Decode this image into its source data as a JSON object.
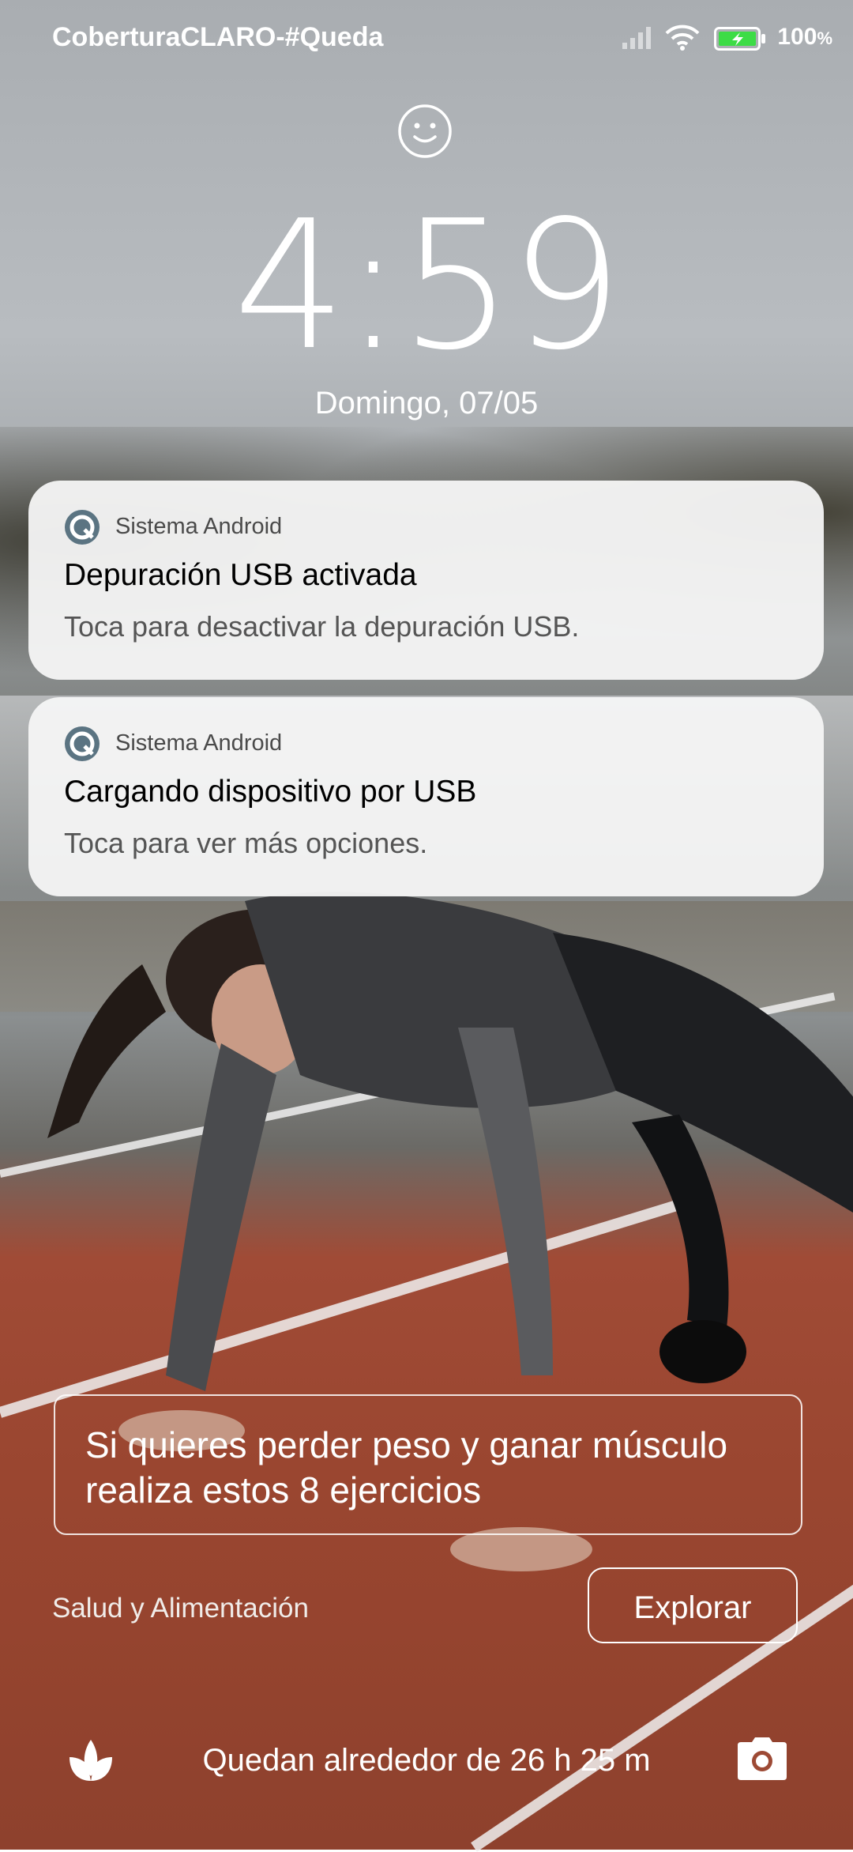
{
  "status_bar": {
    "carrier": "CoberturaCLARO-#Queda",
    "battery_percent": "100",
    "battery_unit": "%"
  },
  "lockscreen": {
    "time": "4:59",
    "date": "Domingo, 07/05"
  },
  "notifications": [
    {
      "app": "Sistema Android",
      "title": "Depuración USB activada",
      "text": "Toca para desactivar la depuración USB."
    },
    {
      "app": "Sistema Android",
      "title": "Cargando dispositivo por USB",
      "text": "Toca para ver más opciones."
    }
  ],
  "wallpaper_card": {
    "headline": "Si quieres perder peso y ganar músculo realiza estos 8 ejercicios",
    "category": "Salud y Alimentación",
    "explore_label": "Explorar"
  },
  "bottom": {
    "battery_remaining": "Quedan alrededor de 26 h 25 m"
  },
  "icons": {
    "signal": "signal-icon",
    "wifi": "wifi-icon",
    "battery": "battery-charging-icon",
    "face_unlock": "face-unlock-icon",
    "notification_app": "android-system-icon",
    "left_shortcut": "tulip-icon",
    "right_shortcut": "camera-icon"
  },
  "colors": {
    "battery_fill": "#3ddc46",
    "notification_bg": "#f6f6f6"
  }
}
